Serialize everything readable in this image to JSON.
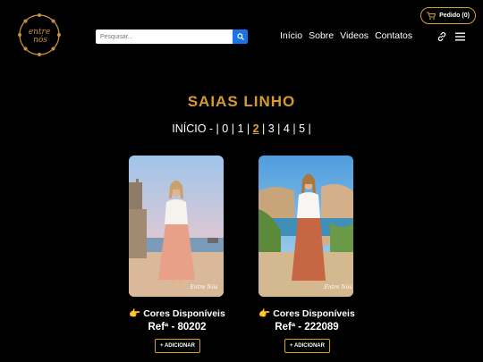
{
  "logo": {
    "text": "entre nós"
  },
  "order_button": {
    "label": "Pedido (0)",
    "icon": "cart-icon"
  },
  "search": {
    "placeholder": "Pesquisar...",
    "icon": "search-icon"
  },
  "nav": {
    "items": [
      "Início",
      "Sobre",
      "Videos",
      "Contatos"
    ]
  },
  "icons": [
    "link-icon",
    "menu-icon"
  ],
  "page_title": "SAIAS LINHO",
  "pagination": {
    "prefix": "INÍCIO -",
    "pages": [
      "0",
      "1",
      "2",
      "3",
      "4",
      "5"
    ],
    "current": "2"
  },
  "products": [
    {
      "watermark": "Entre Nós",
      "colors_label": "Cores Disponíveis",
      "ref": "Refª - 80202",
      "add_label": "+ ADICIONAR"
    },
    {
      "watermark": "Entre Nós",
      "colors_label": "Cores Disponíveis",
      "ref": "Refª - 222089",
      "add_label": "+ ADICIONAR"
    }
  ],
  "colors": {
    "background": "#000000",
    "accent": "#d89a2c",
    "search_button": "#1a73e8"
  }
}
